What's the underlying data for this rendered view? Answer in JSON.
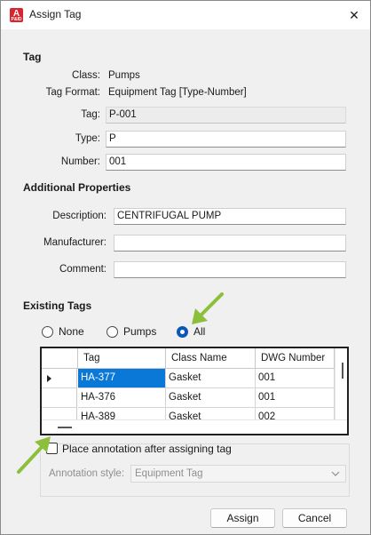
{
  "window": {
    "title": "Assign Tag",
    "app_icon_letter": "A",
    "app_icon_sub": "P&ID"
  },
  "tag_section": {
    "heading": "Tag",
    "class_label": "Class:",
    "class_value": "Pumps",
    "format_label": "Tag Format:",
    "format_value": "Equipment Tag [Type-Number]",
    "tag_label": "Tag:",
    "tag_value": "P-001",
    "type_label": "Type:",
    "type_value": "P",
    "number_label": "Number:",
    "number_value": "001"
  },
  "additional": {
    "heading": "Additional Properties",
    "description_label": "Description:",
    "description_value": "CENTRIFUGAL PUMP",
    "manufacturer_label": "Manufacturer:",
    "manufacturer_value": "",
    "comment_label": "Comment:",
    "comment_value": ""
  },
  "existing": {
    "heading": "Existing Tags",
    "filters": [
      "None",
      "Pumps",
      "All"
    ],
    "selected_filter": "All",
    "columns": [
      "Tag",
      "Class Name",
      "DWG Number"
    ],
    "rows": [
      [
        "HA-377",
        "Gasket",
        "001"
      ],
      [
        "HA-376",
        "Gasket",
        "001"
      ],
      [
        "HA-389",
        "Gasket",
        "002"
      ]
    ]
  },
  "annotation": {
    "checkbox_label": "Place annotation after assigning tag",
    "checked": false,
    "style_label": "Annotation style:",
    "style_value": "Equipment Tag"
  },
  "buttons": {
    "assign": "Assign",
    "cancel": "Cancel"
  },
  "colors": {
    "accent": "#0a78d7",
    "annotation_arrow": "#8cbf3c"
  }
}
